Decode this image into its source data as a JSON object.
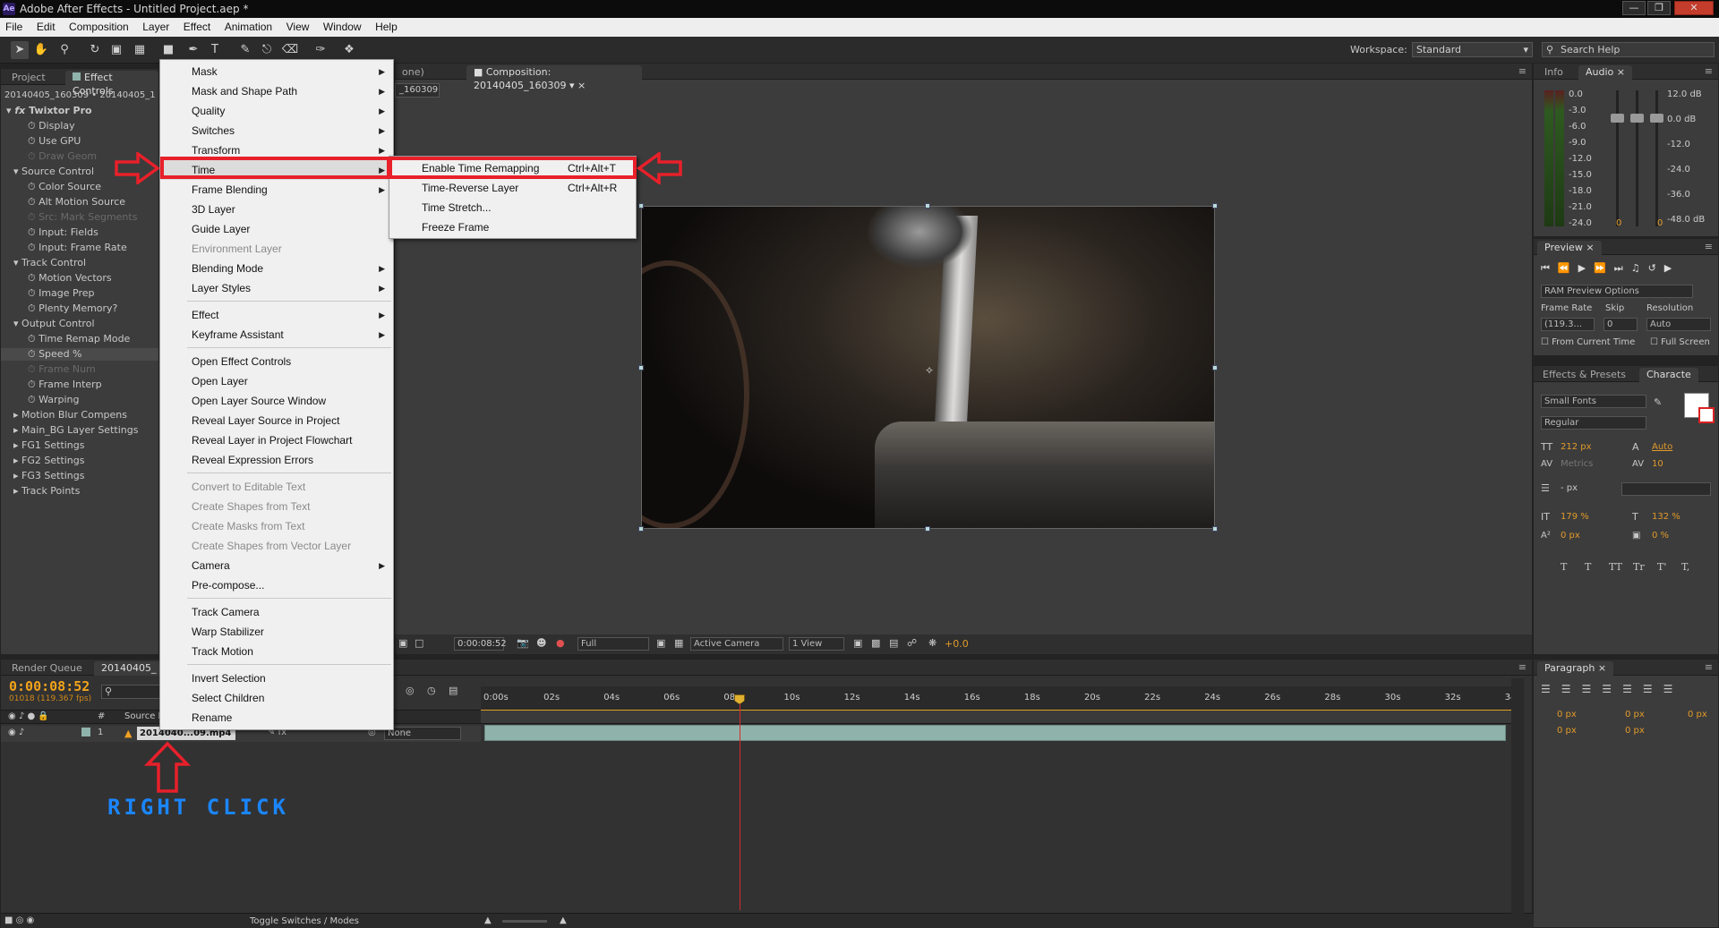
{
  "window": {
    "title": "Adobe After Effects - Untitled Project.aep *",
    "logo": "Ae"
  },
  "menubar": [
    "File",
    "Edit",
    "Composition",
    "Layer",
    "Effect",
    "Animation",
    "View",
    "Window",
    "Help"
  ],
  "toolbar": {
    "workspace_label": "Workspace:",
    "workspace_value": "Standard",
    "search_placeholder": "Search Help"
  },
  "left_panel": {
    "tabs": [
      "Project",
      "Effect Controls"
    ],
    "breadcrumb": "20140405_160309 • 20140405_1",
    "effect_name": "Twixtor Pro",
    "rows": [
      {
        "label": "Display",
        "dim": false
      },
      {
        "label": "Use GPU",
        "dim": false
      },
      {
        "label": "Draw Geom",
        "dim": true
      },
      {
        "label": "Source Control",
        "dim": false
      },
      {
        "label": "Color Source",
        "dim": false
      },
      {
        "label": "Alt Motion Source",
        "dim": false
      },
      {
        "label": "Src: Mark Segments",
        "dim": true
      },
      {
        "label": "Input: Fields",
        "dim": false
      },
      {
        "label": "Input: Frame Rate",
        "dim": false
      },
      {
        "label": "Track Control",
        "dim": false
      },
      {
        "label": "Motion Vectors",
        "dim": false
      },
      {
        "label": "Image Prep",
        "dim": false
      },
      {
        "label": "Plenty Memory?",
        "dim": false
      },
      {
        "label": "Output Control",
        "dim": false
      },
      {
        "label": "Time Remap Mode",
        "dim": false
      },
      {
        "label": "Speed %",
        "dim": false
      },
      {
        "label": "Frame Num",
        "dim": true
      },
      {
        "label": "Frame Interp",
        "dim": false
      },
      {
        "label": "Warping",
        "dim": false
      },
      {
        "label": "Motion Blur Compens",
        "dim": false
      },
      {
        "label": "Main_BG Layer Settings",
        "dim": false
      },
      {
        "label": "FG1 Settings",
        "dim": false
      },
      {
        "label": "FG2 Settings",
        "dim": false
      },
      {
        "label": "FG3 Settings",
        "dim": false
      },
      {
        "label": "Track Points",
        "dim": false
      }
    ]
  },
  "comp_panel": {
    "tab_prefix": "one)",
    "tab": "Composition: 20140405_160309",
    "subtab": "_160309",
    "timecode": "0:00:08:52",
    "resolution": "Full",
    "camera": "Active Camera",
    "view": "1 View",
    "exposure": "+0.0"
  },
  "context_menu": {
    "items": [
      {
        "label": "Mask",
        "sub": true,
        "dis": false
      },
      {
        "label": "Mask and Shape Path",
        "sub": true,
        "dis": false
      },
      {
        "label": "Quality",
        "sub": true,
        "dis": false
      },
      {
        "label": "Switches",
        "sub": true,
        "dis": false
      },
      {
        "label": "Transform",
        "sub": true,
        "dis": false
      },
      {
        "label": "Time",
        "sub": true,
        "dis": false
      },
      {
        "label": "Frame Blending",
        "sub": true,
        "dis": false
      },
      {
        "label": "3D Layer",
        "sub": false,
        "dis": false
      },
      {
        "label": "Guide Layer",
        "sub": false,
        "dis": false
      },
      {
        "label": "Environment Layer",
        "sub": false,
        "dis": true
      },
      {
        "label": "Blending Mode",
        "sub": true,
        "dis": false
      },
      {
        "label": "Layer Styles",
        "sub": true,
        "dis": false
      },
      {
        "label": "Effect",
        "sub": true,
        "dis": false
      },
      {
        "label": "Keyframe Assistant",
        "sub": true,
        "dis": false
      },
      {
        "label": "Open Effect Controls",
        "sub": false,
        "dis": false
      },
      {
        "label": "Open Layer",
        "sub": false,
        "dis": false
      },
      {
        "label": "Open Layer Source Window",
        "sub": false,
        "dis": false
      },
      {
        "label": "Reveal Layer Source in Project",
        "sub": false,
        "dis": false
      },
      {
        "label": "Reveal Layer in Project Flowchart",
        "sub": false,
        "dis": false
      },
      {
        "label": "Reveal Expression Errors",
        "sub": false,
        "dis": false
      },
      {
        "label": "Convert to Editable Text",
        "sub": false,
        "dis": true
      },
      {
        "label": "Create Shapes from Text",
        "sub": false,
        "dis": true
      },
      {
        "label": "Create Masks from Text",
        "sub": false,
        "dis": true
      },
      {
        "label": "Create Shapes from Vector Layer",
        "sub": false,
        "dis": true
      },
      {
        "label": "Camera",
        "sub": true,
        "dis": false
      },
      {
        "label": "Pre-compose...",
        "sub": false,
        "dis": false
      },
      {
        "label": "Track Camera",
        "sub": false,
        "dis": false
      },
      {
        "label": "Warp Stabilizer",
        "sub": false,
        "dis": false
      },
      {
        "label": "Track Motion",
        "sub": false,
        "dis": false
      },
      {
        "label": "Invert Selection",
        "sub": false,
        "dis": false
      },
      {
        "label": "Select Children",
        "sub": false,
        "dis": false
      },
      {
        "label": "Rename",
        "sub": false,
        "dis": false
      }
    ]
  },
  "time_submenu": {
    "items": [
      {
        "label": "Enable Time Remapping",
        "shortcut": "Ctrl+Alt+T"
      },
      {
        "label": "Time-Reverse Layer",
        "shortcut": "Ctrl+Alt+R"
      },
      {
        "label": "Time Stretch...",
        "shortcut": ""
      },
      {
        "label": "Freeze Frame",
        "shortcut": ""
      }
    ]
  },
  "annotation": {
    "label": "RIGHT CLICK"
  },
  "timeline": {
    "tabs": [
      "Render Queue",
      "20140405_"
    ],
    "timecode": "0:00:08:52",
    "fps": "01018 (119.367 fps)",
    "col_num": "#",
    "col_source": "Source Na",
    "layer_num": "1",
    "layer_name": "2014040...09.mp4",
    "parent": "None",
    "ticks": [
      "0:00s",
      "02s",
      "04s",
      "06s",
      "08s",
      "10s",
      "12s",
      "14s",
      "16s",
      "18s",
      "20s",
      "22s",
      "24s",
      "26s",
      "28s",
      "30s",
      "32s",
      "34s"
    ],
    "footer": "Toggle Switches / Modes"
  },
  "right_panels": {
    "info_tabs": [
      "Info",
      "Audio"
    ],
    "meter_left": [
      "0.0",
      "-3.0",
      "-6.0",
      "-9.0",
      "-12.0",
      "-15.0",
      "-18.0",
      "-21.0",
      "-24.0"
    ],
    "meter_right": [
      "12.0 dB",
      "0.0 dB",
      "-12.0",
      "-24.0",
      "-36.0",
      "-48.0 dB"
    ],
    "meter_values": [
      "0",
      "0"
    ],
    "preview_tab": "Preview",
    "ram_preview": "RAM Preview Options",
    "frame_rate_label": "Frame Rate",
    "skip_label": "Skip",
    "resolution_label": "Resolution",
    "frame_rate_value": "(119.3...",
    "skip_value": "0",
    "resolution_value": "Auto",
    "from_current": "From Current Time",
    "full_screen": "Full Screen",
    "effects_tab": "Effects & Presets",
    "character_tab": "Characte",
    "font": "Small Fonts",
    "style": "Regular",
    "font_size": "212 px",
    "leading": "Auto",
    "kerning": "Metrics",
    "tracking": "10",
    "stroke_unit": "- px",
    "vscale": "179 %",
    "hscale": "132 %",
    "baseline": "0 px",
    "tsume": "0 %",
    "paragraph_tab": "Paragraph",
    "para_vals": [
      "0 px",
      "0 px",
      "0 px",
      "0 px",
      "0 px"
    ],
    "text_buttons": [
      "T",
      "T",
      "TT",
      "Tr",
      "T'",
      "T,"
    ]
  }
}
